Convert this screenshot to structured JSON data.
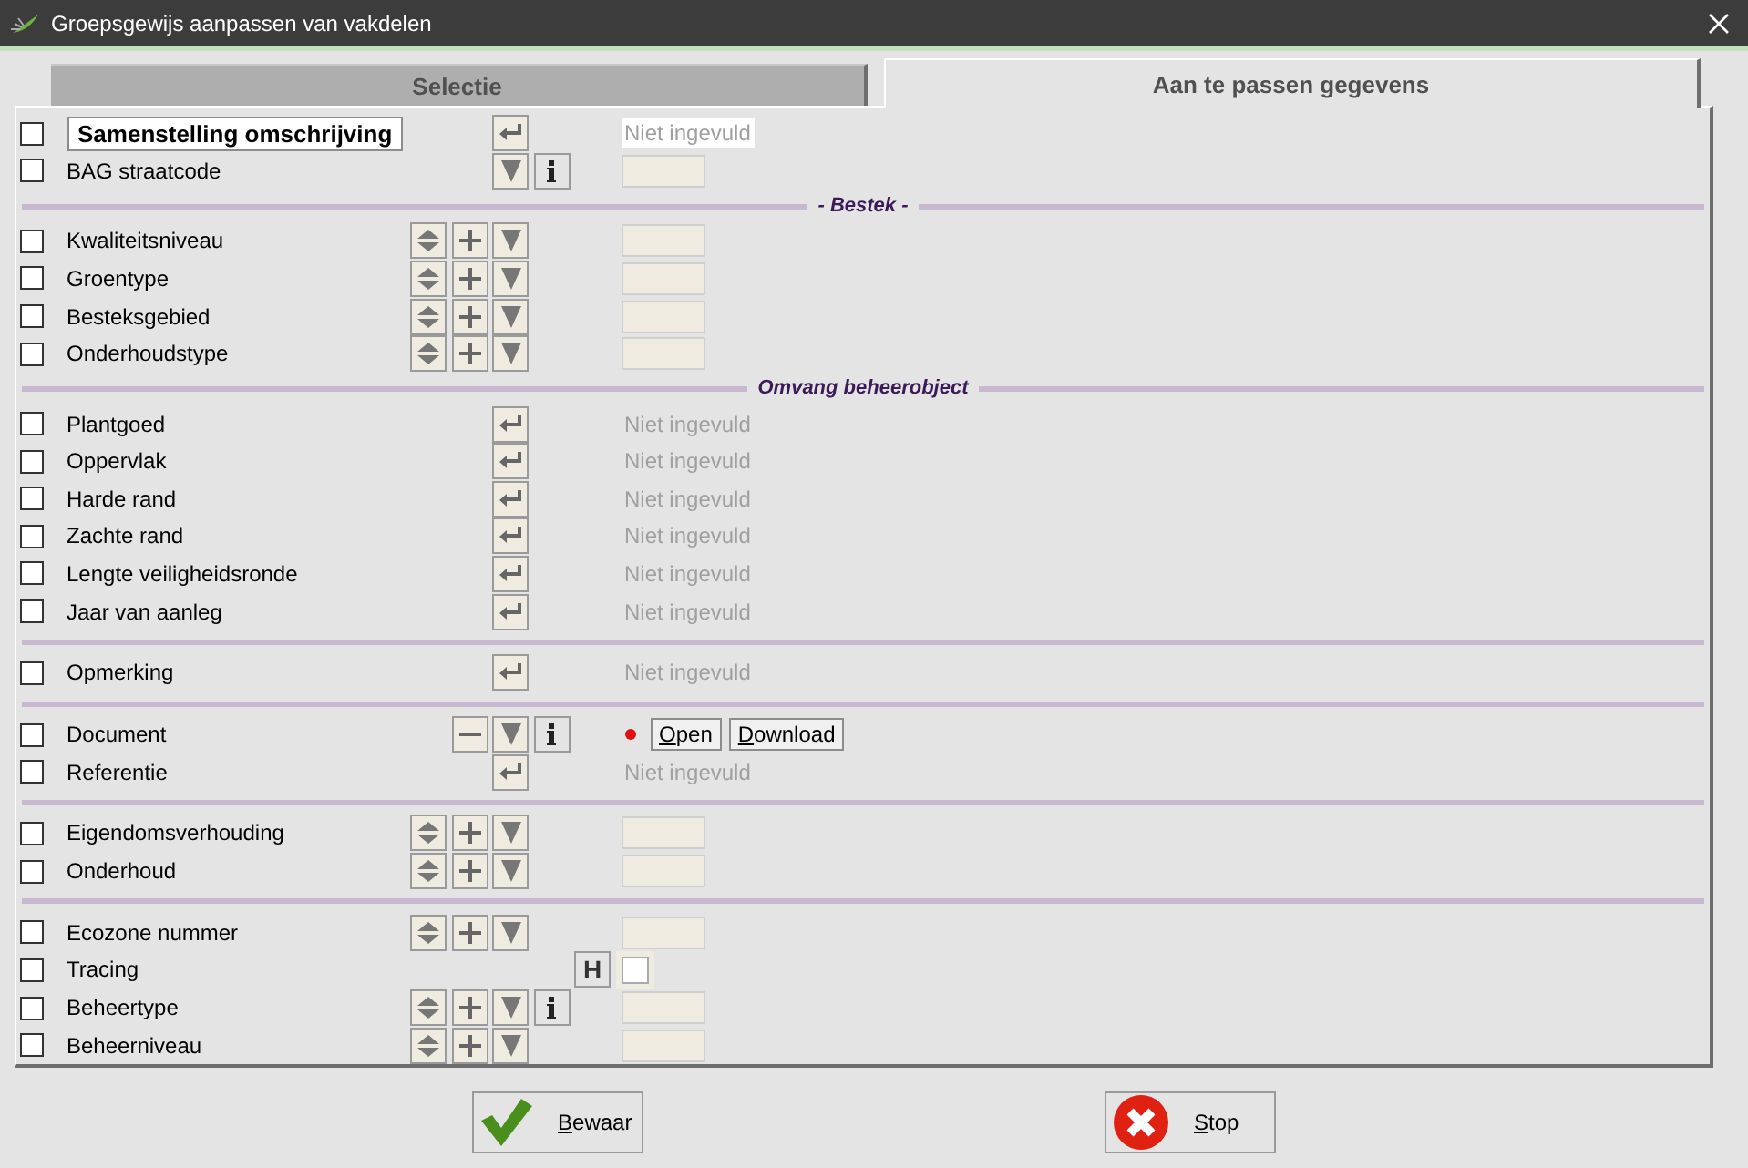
{
  "window": {
    "title": "Groepsgewijs aanpassen van vakdelen"
  },
  "tabs": [
    {
      "label": "Selectie",
      "selected": false
    },
    {
      "label": "Aan te passen gegevens",
      "selected": true
    }
  ],
  "rows": [
    {
      "kind": "field",
      "label": "Samenstelling omschrijving",
      "emphasized": true,
      "checked": false,
      "buttons": [
        {
          "kind": "enter"
        }
      ],
      "value": {
        "kind": "text",
        "placeholder": "Niet ingevuld",
        "highlighted": true
      }
    },
    {
      "kind": "field",
      "label": "BAG straatcode",
      "checked": false,
      "buttons": [
        {
          "kind": "dropdown"
        },
        {
          "kind": "info"
        }
      ],
      "value": {
        "kind": "box"
      }
    },
    {
      "kind": "section",
      "title": "- Bestek -"
    },
    {
      "kind": "field",
      "label": "Kwaliteitsniveau",
      "checked": false,
      "buttons": [
        {
          "kind": "updown"
        },
        {
          "kind": "plus"
        },
        {
          "kind": "dropdown"
        }
      ],
      "value": {
        "kind": "box"
      }
    },
    {
      "kind": "field",
      "label": "Groentype",
      "checked": false,
      "buttons": [
        {
          "kind": "updown"
        },
        {
          "kind": "plus"
        },
        {
          "kind": "dropdown"
        }
      ],
      "value": {
        "kind": "box"
      }
    },
    {
      "kind": "field",
      "label": "Besteksgebied",
      "checked": false,
      "buttons": [
        {
          "kind": "updown"
        },
        {
          "kind": "plus"
        },
        {
          "kind": "dropdown"
        }
      ],
      "value": {
        "kind": "box"
      }
    },
    {
      "kind": "field",
      "label": "Onderhoudstype",
      "checked": false,
      "buttons": [
        {
          "kind": "updown"
        },
        {
          "kind": "plus"
        },
        {
          "kind": "dropdown"
        }
      ],
      "value": {
        "kind": "box"
      }
    },
    {
      "kind": "section",
      "title": "Omvang beheerobject"
    },
    {
      "kind": "field",
      "label": "Plantgoed",
      "checked": false,
      "buttons": [
        {
          "kind": "enter"
        }
      ],
      "value": {
        "kind": "text",
        "placeholder": "Niet ingevuld"
      }
    },
    {
      "kind": "field",
      "label": "Oppervlak",
      "checked": false,
      "buttons": [
        {
          "kind": "enter"
        }
      ],
      "value": {
        "kind": "text",
        "placeholder": "Niet ingevuld"
      }
    },
    {
      "kind": "field",
      "label": "Harde rand",
      "checked": false,
      "buttons": [
        {
          "kind": "enter"
        }
      ],
      "value": {
        "kind": "text",
        "placeholder": "Niet ingevuld"
      }
    },
    {
      "kind": "field",
      "label": "Zachte rand",
      "checked": false,
      "buttons": [
        {
          "kind": "enter"
        }
      ],
      "value": {
        "kind": "text",
        "placeholder": "Niet ingevuld"
      }
    },
    {
      "kind": "field",
      "label": "Lengte veiligheidsronde",
      "checked": false,
      "buttons": [
        {
          "kind": "enter"
        }
      ],
      "value": {
        "kind": "text",
        "placeholder": "Niet ingevuld"
      }
    },
    {
      "kind": "field",
      "label": "Jaar van aanleg",
      "checked": false,
      "buttons": [
        {
          "kind": "enter"
        }
      ],
      "value": {
        "kind": "text",
        "placeholder": "Niet ingevuld"
      }
    },
    {
      "kind": "section"
    },
    {
      "kind": "field",
      "label": "Opmerking",
      "checked": false,
      "buttons": [
        {
          "kind": "enter"
        }
      ],
      "value": {
        "kind": "text",
        "placeholder": "Niet ingevuld"
      }
    },
    {
      "kind": "section"
    },
    {
      "kind": "field",
      "label": "Document",
      "checked": false,
      "buttons": [
        {
          "kind": "minus"
        },
        {
          "kind": "dropdown"
        },
        {
          "kind": "info"
        }
      ],
      "value": {
        "kind": "document",
        "actions": [
          {
            "label": "Open",
            "mnemonic": true
          },
          {
            "label": "Download",
            "mnemonic": true
          }
        ]
      }
    },
    {
      "kind": "field",
      "label": "Referentie",
      "checked": false,
      "buttons": [
        {
          "kind": "enter"
        }
      ],
      "value": {
        "kind": "text",
        "placeholder": "Niet ingevuld"
      }
    },
    {
      "kind": "section"
    },
    {
      "kind": "field",
      "label": "Eigendomsverhouding",
      "checked": false,
      "buttons": [
        {
          "kind": "updown"
        },
        {
          "kind": "plus"
        },
        {
          "kind": "dropdown"
        }
      ],
      "value": {
        "kind": "box"
      }
    },
    {
      "kind": "field",
      "label": "Onderhoud",
      "checked": false,
      "buttons": [
        {
          "kind": "updown"
        },
        {
          "kind": "plus"
        },
        {
          "kind": "dropdown"
        }
      ],
      "value": {
        "kind": "box"
      }
    },
    {
      "kind": "section"
    },
    {
      "kind": "field",
      "label": "Ecozone nummer",
      "checked": false,
      "buttons": [
        {
          "kind": "updown"
        },
        {
          "kind": "plus"
        },
        {
          "kind": "dropdown"
        }
      ],
      "value": {
        "kind": "box"
      }
    },
    {
      "kind": "field",
      "label": "Tracing",
      "checked": false,
      "buttons": [
        {
          "kind": "h"
        }
      ],
      "h_label": "H",
      "value": {
        "kind": "checkbox",
        "checked": false
      }
    },
    {
      "kind": "field",
      "label": "Beheertype",
      "checked": false,
      "buttons": [
        {
          "kind": "updown"
        },
        {
          "kind": "plus"
        },
        {
          "kind": "dropdown"
        },
        {
          "kind": "info"
        }
      ],
      "value": {
        "kind": "box"
      }
    },
    {
      "kind": "field",
      "label": "Beheerniveau",
      "checked": false,
      "buttons": [
        {
          "kind": "updown"
        },
        {
          "kind": "plus"
        },
        {
          "kind": "dropdown"
        }
      ],
      "value": {
        "kind": "box"
      }
    }
  ],
  "actions": [
    {
      "kind": "save",
      "label": "Bewaar",
      "mnemonic": true
    },
    {
      "kind": "stop",
      "label": "Stop",
      "mnemonic": true
    }
  ]
}
